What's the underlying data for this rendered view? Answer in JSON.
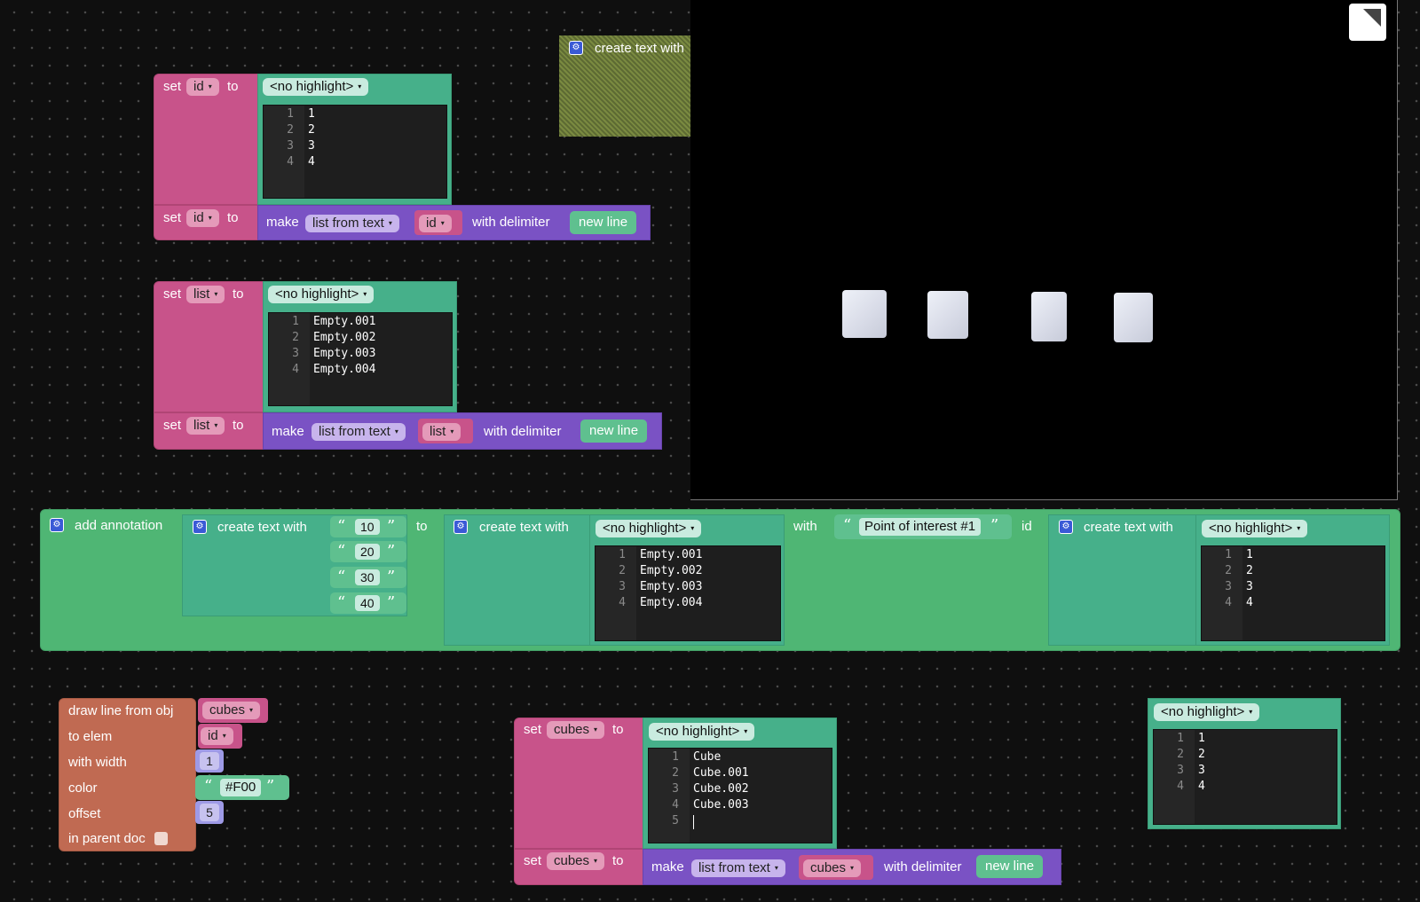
{
  "colors": {
    "set_block": "#c8538a",
    "make_block": "#7a52c4",
    "text_block": "#46b08a",
    "annotation_block": "#4fb674",
    "draw_block": "#c06a52",
    "viewport": "#000000"
  },
  "icons": {
    "gear": "gear-icon",
    "corner": "fullscreen-corner-icon",
    "dropdown": "dropdown-arrow-icon",
    "quote_open": "open-quote-icon",
    "quote_close": "close-quote-icon"
  },
  "common": {
    "set": "set",
    "to": "to",
    "make": "make",
    "list_from_text": "list from text",
    "with_delimiter": "with delimiter",
    "new_line": "new line",
    "no_highlight": "<no highlight>",
    "create_text_with": "create text with",
    "dropdown_arrow": "▾",
    "quote_open": "“",
    "quote_close": "”"
  },
  "floating_text": {
    "label": "create text with"
  },
  "block_id": {
    "var": "id",
    "lines": [
      "1",
      "2",
      "3",
      "4"
    ]
  },
  "block_list": {
    "var": "list",
    "lines": [
      "Empty.001",
      "Empty.002",
      "Empty.003",
      "Empty.004"
    ]
  },
  "annotation": {
    "title": "add annotation",
    "numbers": [
      "10",
      "20",
      "30",
      "40"
    ],
    "to": "to",
    "with": "with",
    "id": "id",
    "point_text": "Point of interest #1",
    "list_lines": [
      "Empty.001",
      "Empty.002",
      "Empty.003",
      "Empty.004"
    ],
    "id_lines": [
      "1",
      "2",
      "3",
      "4"
    ]
  },
  "draw_line": {
    "from_obj": "draw line from obj",
    "from_value": "cubes",
    "to_elem": "to elem",
    "to_value": "id",
    "with_width": "with width",
    "width_value": "1",
    "color": "color",
    "color_value": "#F00",
    "offset": "offset",
    "offset_value": "5",
    "in_parent_doc": "in parent doc"
  },
  "block_cubes": {
    "var": "cubes",
    "lines": [
      "Cube",
      "Cube.001",
      "Cube.002",
      "Cube.003",
      ""
    ]
  },
  "standalone_text": {
    "lines": [
      "1",
      "2",
      "3",
      "4"
    ]
  },
  "line_numbers": [
    "1",
    "2",
    "3",
    "4",
    "5"
  ]
}
